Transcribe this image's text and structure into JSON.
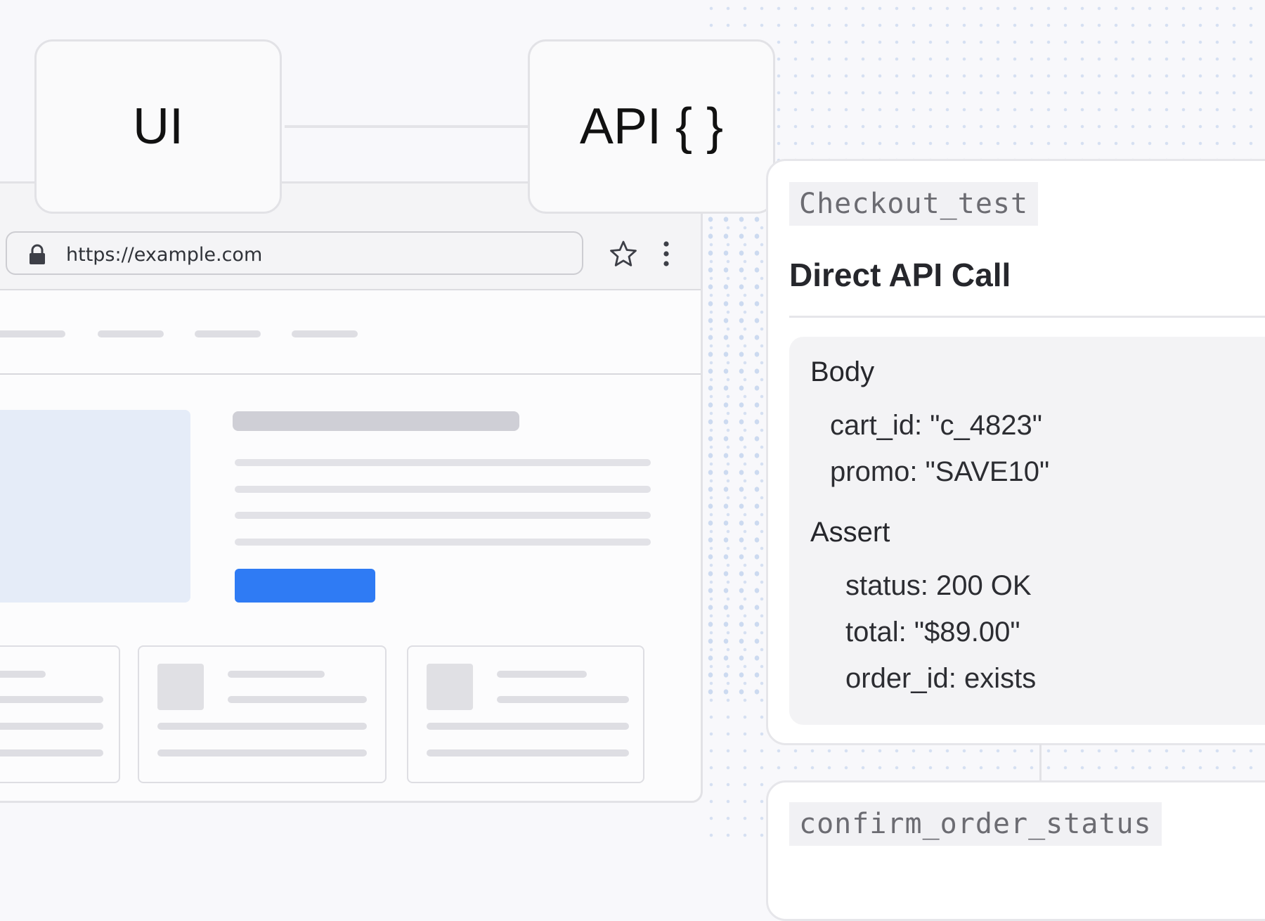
{
  "labels": {
    "ui": "UI",
    "api": "API { }"
  },
  "browser": {
    "url": "https://example.com",
    "accent_color": "#2f7bf4"
  },
  "api_panel": {
    "test_name": "Checkout_test",
    "title": "Direct API Call",
    "body_heading": "Body",
    "body_fields": [
      "cart_id: \"c_4823\"",
      "promo: \"SAVE10\""
    ],
    "assert_heading": "Assert",
    "assert_fields": [
      "status: 200 OK",
      "total: \"$89.00\"",
      "order_id: exists"
    ]
  },
  "next_panel": {
    "test_name": "confirm_order_status"
  }
}
